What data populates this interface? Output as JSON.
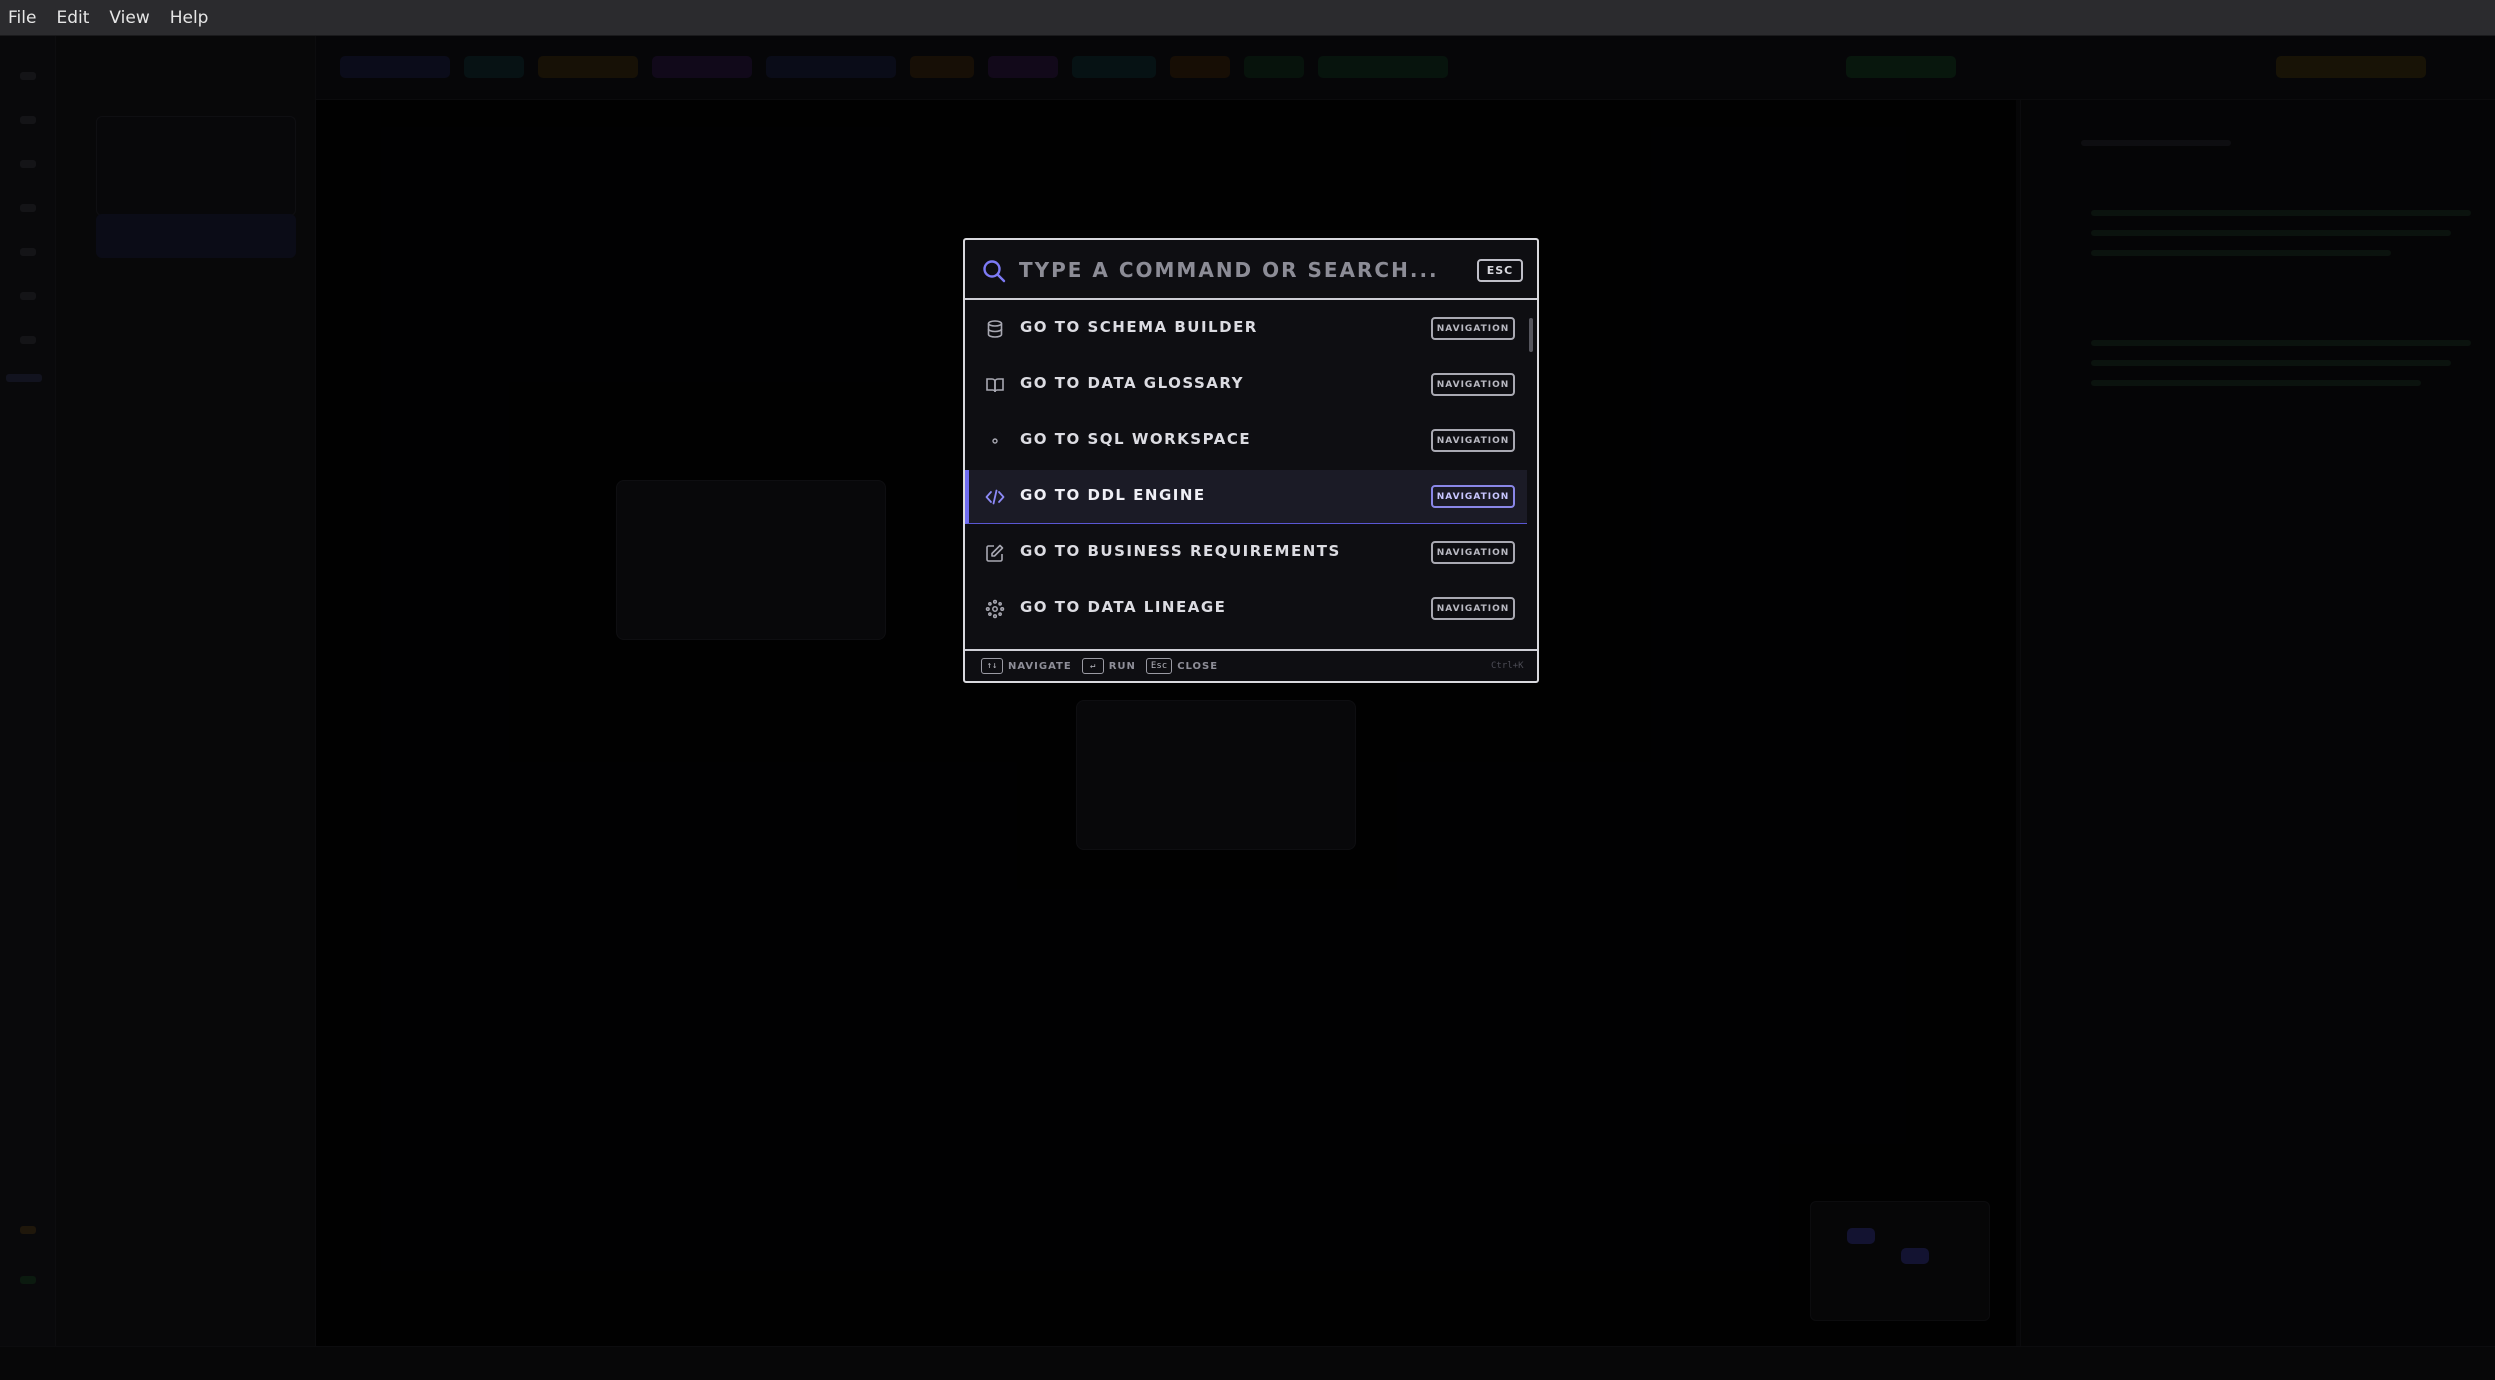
{
  "menubar": {
    "items": [
      "File",
      "Edit",
      "View",
      "Help"
    ]
  },
  "palette": {
    "search": {
      "value": "",
      "placeholder": "TYPE A COMMAND OR SEARCH...",
      "esc_label": "ESC"
    },
    "items": [
      {
        "label": "GO TO SCHEMA BUILDER",
        "tag": "NAVIGATION",
        "icon": "database-icon"
      },
      {
        "label": "GO TO DATA GLOSSARY",
        "tag": "NAVIGATION",
        "icon": "book-icon"
      },
      {
        "label": "GO TO SQL WORKSPACE",
        "tag": "NAVIGATION",
        "icon": "dot-icon"
      },
      {
        "label": "GO TO DDL ENGINE",
        "tag": "NAVIGATION",
        "icon": "code-icon",
        "active": true
      },
      {
        "label": "GO TO BUSINESS REQUIREMENTS",
        "tag": "NAVIGATION",
        "icon": "edit-icon"
      },
      {
        "label": "GO TO DATA LINEAGE",
        "tag": "NAVIGATION",
        "icon": "lineage-icon"
      }
    ],
    "footer": {
      "navigate_key": "↑↓",
      "navigate_label": "NAVIGATE",
      "run_key": "↵",
      "run_label": "RUN",
      "close_key": "Esc",
      "close_label": "CLOSE",
      "shortcut": "Ctrl+K"
    }
  },
  "colors": {
    "accent": "#6f6cf0",
    "palette_bg": "#0e0e12",
    "border": "#d9d9de"
  }
}
